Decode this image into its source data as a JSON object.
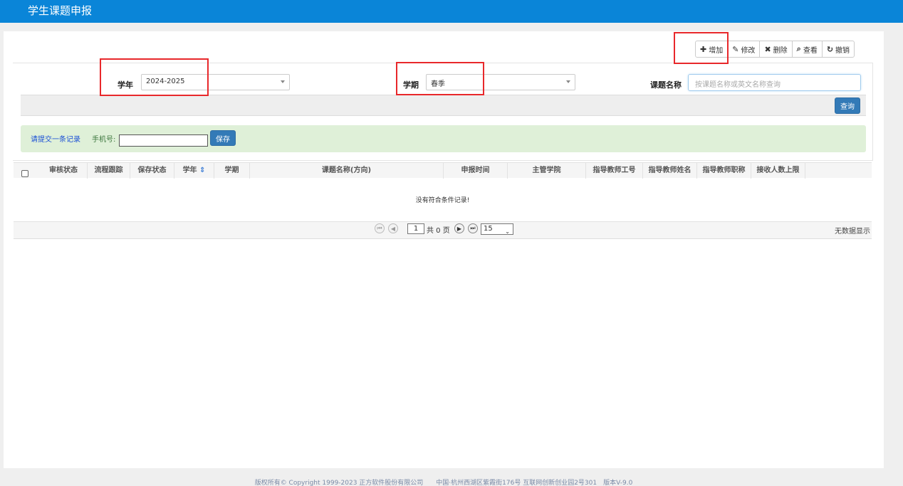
{
  "header": {
    "title": "学生课题申报"
  },
  "toolbar": {
    "add": "增加",
    "edit": "修改",
    "delete": "删除",
    "view": "查看",
    "revoke": "撤销"
  },
  "search": {
    "year_label": "学年",
    "year_value": "2024-2025",
    "term_label": "学期",
    "term_value": "春季",
    "topic_label": "课题名称",
    "topic_placeholder": "按课题名称或英文名称查询",
    "query_button": "查询"
  },
  "notice": {
    "message": "请提交一条记录",
    "phone_label": "手机号:",
    "save_button": "保存"
  },
  "table": {
    "columns": [
      "审核状态",
      "流程跟踪",
      "保存状态",
      "学年",
      "学期",
      "课题名称(方向)",
      "申报时间",
      "主管学院",
      "指导教师工号",
      "指导教师姓名",
      "指导教师职称",
      "接收人数上限"
    ],
    "empty_text": "没有符合条件记录!"
  },
  "pager": {
    "current_page": "1",
    "total_text": "共 0 页",
    "page_size": "15",
    "right_text": "无数据显示"
  },
  "footer": {
    "text": "版权所有© Copyright 1999-2023 正方软件股份有限公司　　中国·杭州西湖区紫霞街176号 互联网创新创业园2号301　版本V-9.0"
  },
  "colors": {
    "topbar": "#0a85d8",
    "highlight": "#e8282b",
    "primary": "#337ab7",
    "notice_bg": "#dff0d8"
  }
}
